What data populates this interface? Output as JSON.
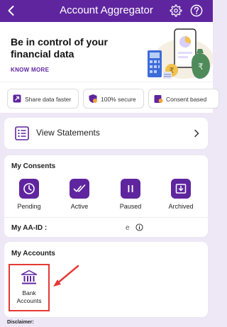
{
  "header": {
    "title": "Account Aggregator"
  },
  "banner": {
    "headline": "Be in control of your financial data",
    "know_more": "KNOW MORE"
  },
  "chips": [
    {
      "label": "Share data faster",
      "icon": "share-data-icon"
    },
    {
      "label": "100% secure",
      "icon": "shield-lock-icon"
    },
    {
      "label": "Consent based",
      "icon": "consent-icon"
    }
  ],
  "view_statements": {
    "label": "View Statements"
  },
  "consents": {
    "heading": "My Consents",
    "items": [
      {
        "label": "Pending",
        "icon": "clock-icon"
      },
      {
        "label": "Active",
        "icon": "double-check-icon"
      },
      {
        "label": "Paused",
        "icon": "pause-icon"
      },
      {
        "label": "Archived",
        "icon": "archive-icon"
      }
    ],
    "aa_id_label": "My AA-ID :",
    "aa_id_value": "е"
  },
  "accounts": {
    "heading": "My Accounts",
    "bank_line1": "Bank",
    "bank_line2": "Accounts"
  },
  "disclaimer": "Disclaimer:",
  "colors": {
    "primary": "#5f259f",
    "background": "#ede7f6",
    "highlight": "#e53935"
  }
}
